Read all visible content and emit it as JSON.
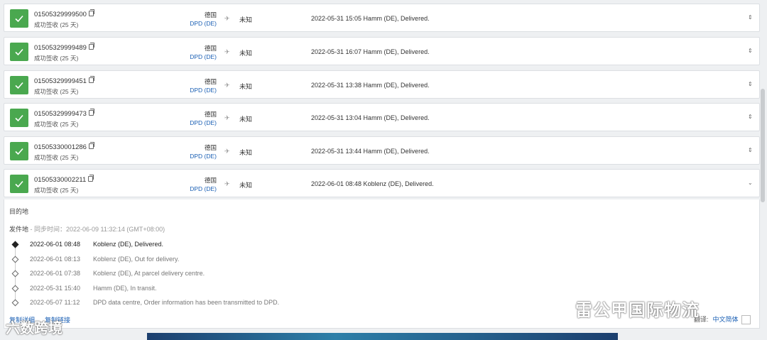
{
  "shipments": [
    {
      "number": "01505329999500",
      "status": "成功签收 (25 天)",
      "country": "德国",
      "carrier": "DPD (DE)",
      "destination": "未知",
      "latest": "2022-05-31 15:05  Hamm (DE), Delivered."
    },
    {
      "number": "01505329999489",
      "status": "成功签收 (25 天)",
      "country": "德国",
      "carrier": "DPD (DE)",
      "destination": "未知",
      "latest": "2022-05-31 16:07  Hamm (DE), Delivered."
    },
    {
      "number": "01505329999451",
      "status": "成功签收 (25 天)",
      "country": "德国",
      "carrier": "DPD (DE)",
      "destination": "未知",
      "latest": "2022-05-31 13:38  Hamm (DE), Delivered."
    },
    {
      "number": "01505329999473",
      "status": "成功签收 (25 天)",
      "country": "德国",
      "carrier": "DPD (DE)",
      "destination": "未知",
      "latest": "2022-05-31 13:04  Hamm (DE), Delivered."
    },
    {
      "number": "01505330001286",
      "status": "成功签收 (25 天)",
      "country": "德国",
      "carrier": "DPD (DE)",
      "destination": "未知",
      "latest": "2022-05-31 13:44  Hamm (DE), Delivered."
    },
    {
      "number": "01505330002211",
      "status": "成功签收 (25 天)",
      "country": "德国",
      "carrier": "DPD (DE)",
      "destination": "未知",
      "latest": "2022-06-01 08:48  Koblenz (DE), Delivered."
    }
  ],
  "detail": {
    "destination_label": "目的地",
    "origin_label": "发件地",
    "sync_text": " - 同步时间：2022-06-09 11:32:14 (GMT+08:00)",
    "events": [
      {
        "time": "2022-06-01 08:48",
        "desc": "Koblenz (DE), Delivered."
      },
      {
        "time": "2022-06-01 08:13",
        "desc": "Koblenz (DE), Out for delivery."
      },
      {
        "time": "2022-06-01 07:38",
        "desc": "Koblenz (DE), At parcel delivery centre."
      },
      {
        "time": "2022-05-31 15:40",
        "desc": "Hamm (DE), In transit."
      },
      {
        "time": "2022-05-07 11:12",
        "desc": "DPD data centre, Order information has been transmitted to DPD."
      }
    ],
    "copy_info": "复制详细",
    "copy_link": "复制链接"
  },
  "translate": {
    "label": "翻译:",
    "lang": "中文简体"
  },
  "watermarks": {
    "right": "雷公甲国际物流",
    "left": "六数跨境"
  },
  "colors": {
    "success": "#4aa84f",
    "link": "#1a5fb4"
  }
}
